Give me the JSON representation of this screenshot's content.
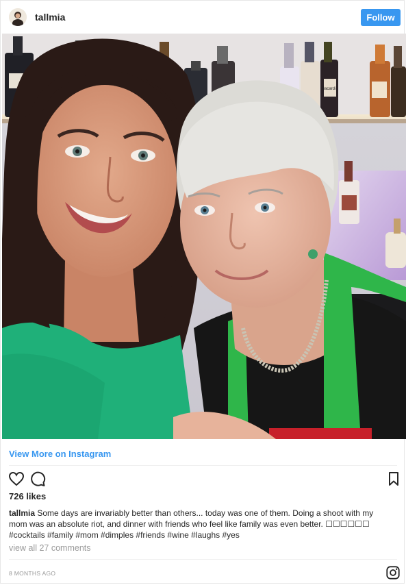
{
  "header": {
    "username": "tallmia",
    "follow_label": "Follow"
  },
  "photo": {
    "bottle_label": "Bacardi"
  },
  "embed": {
    "view_more_label": "View More on Instagram"
  },
  "post": {
    "likes": "726 likes",
    "caption_user": "tallmia",
    "caption_text": "Some days are invariably better than others... today was one of them. Doing a shoot with my mom was an absolute riot, and dinner with friends who feel like family was even better. ☐☐☐☐☐☐",
    "hashtags": "#cocktails #family #mom #dimples #friends #wine #laughs #yes",
    "view_comments": "view all 27 comments",
    "timestamp": "8 MONTHS AGO"
  },
  "colors": {
    "follow_blue": "#3897f0",
    "link_blue": "#3897f0",
    "muted_gray": "#999999",
    "divider": "#efefef"
  },
  "icons": [
    "heart-icon",
    "comment-icon",
    "bookmark-icon",
    "instagram-icon"
  ]
}
